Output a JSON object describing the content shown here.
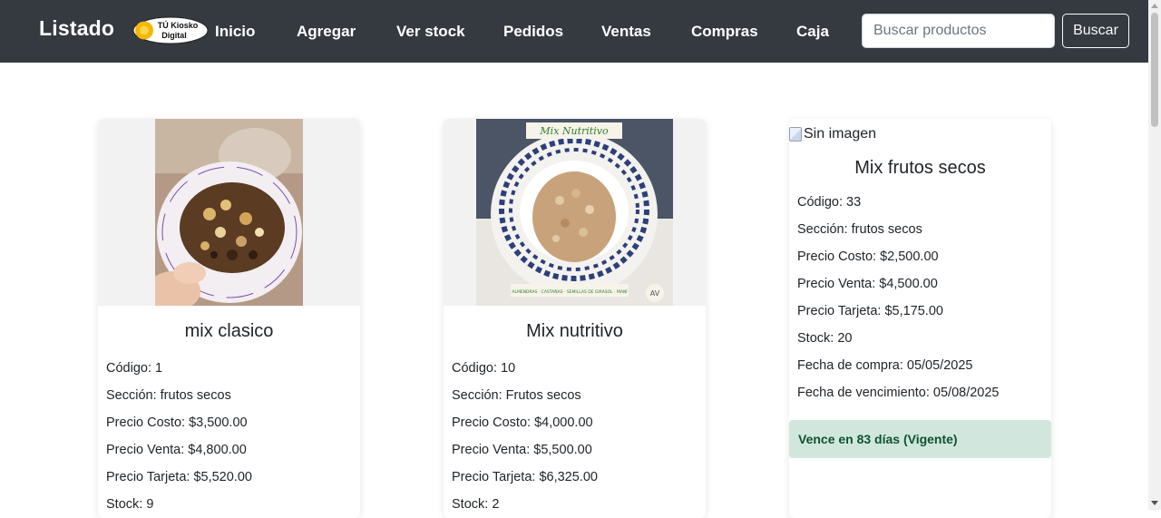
{
  "brand": "Listado",
  "logo": {
    "line1": "TÚ Kiosko",
    "line2": "Digital"
  },
  "nav": [
    "Inicio",
    "Agregar",
    "Ver stock",
    "Pedidos",
    "Ventas",
    "Compras",
    "Caja"
  ],
  "search": {
    "placeholder": "Buscar productos",
    "value": "",
    "button": "Buscar"
  },
  "products": [
    {
      "name": "mix clasico",
      "image_alt": "",
      "lines": [
        "Código: 1",
        "Sección: frutos secos",
        "Precio Costo: $3,500.00",
        "Precio Venta: $4,800.00",
        "Precio Tarjeta: $5,520.00",
        "Stock: 9"
      ]
    },
    {
      "name": "Mix nutritivo",
      "image_overlay_title": "Mix Nutritivo",
      "image_overlay_caption": "ALMENDRAS · CASTAÑAS · SEMILLAS DE GIRASOL · MANÍ",
      "image_badge": "AV",
      "lines": [
        "Código: 10",
        "Sección: Frutos secos",
        "Precio Costo: $4,000.00",
        "Precio Venta: $5,500.00",
        "Precio Tarjeta: $6,325.00",
        "Stock: 2"
      ]
    },
    {
      "name": "Mix frutos secos",
      "image_alt": "Sin imagen",
      "lines": [
        "Código: 33",
        "Sección: frutos secos",
        "Precio Costo: $2,500.00",
        "Precio Venta: $4,500.00",
        "Precio Tarjeta: $5,175.00",
        "Stock: 20",
        "Fecha de compra: 05/05/2025",
        "Fecha de vencimiento: 05/08/2025"
      ],
      "alert": "Vence en 83 días (Vigente)"
    }
  ],
  "colors": {
    "navbar": "#343a40",
    "alert_bg": "#d1e7dd",
    "alert_text": "#0f5132"
  }
}
